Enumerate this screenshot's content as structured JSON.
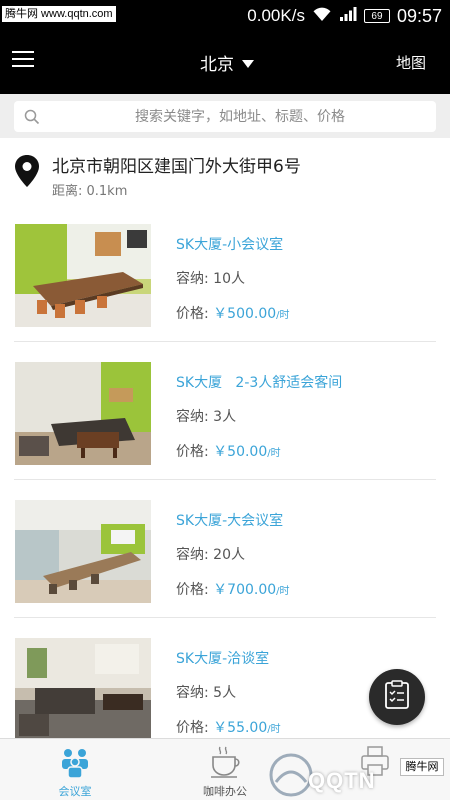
{
  "status_bar": {
    "watermark": "腾牛网 www.qqtn.com",
    "net_speed": "0.00K/s",
    "battery": "69",
    "time": "09:57"
  },
  "header": {
    "city": "北京",
    "map_label": "地图"
  },
  "search": {
    "placeholder": "搜索关键字，如地址、标题、价格"
  },
  "location": {
    "address": "北京市朝阳区建国门外大街甲6号",
    "distance": "距离: 0.1km"
  },
  "rooms": [
    {
      "name": "SK大厦-小会议室",
      "capacity_label": "容纳:",
      "capacity": "10人",
      "price_label": "价格:",
      "price": "￥500.00",
      "unit": "/时"
    },
    {
      "name": "SK大厦   2-3人舒适会客间",
      "capacity_label": "容纳:",
      "capacity": "3人",
      "price_label": "价格:",
      "price": "￥50.00",
      "unit": "/时"
    },
    {
      "name": "SK大厦-大会议室",
      "capacity_label": "容纳:",
      "capacity": "20人",
      "price_label": "价格:",
      "price": "￥700.00",
      "unit": "/时"
    },
    {
      "name": "SK大厦-洽谈室",
      "capacity_label": "容纳:",
      "capacity": "5人",
      "price_label": "价格:",
      "price": "￥55.00",
      "unit": "/时"
    }
  ],
  "tabs": [
    {
      "label": "会议室"
    },
    {
      "label": "咖啡办公"
    },
    {
      "label": ""
    }
  ],
  "watermark_bottom": {
    "qqtn": "QQTN",
    "tengniu": "腾牛网"
  },
  "colors": {
    "accent": "#3ba4d8",
    "header_bg": "#000000",
    "fab_bg": "#2a2a2a"
  },
  "icons": {
    "menu": "hamburger-icon",
    "city_dropdown": "caret-down-icon",
    "search": "search-icon",
    "location": "map-pin-icon",
    "fab": "clipboard-list-icon",
    "tab_meeting": "people-icon",
    "tab_coffee": "coffee-cup-icon",
    "tab_third": "printer-icon"
  }
}
